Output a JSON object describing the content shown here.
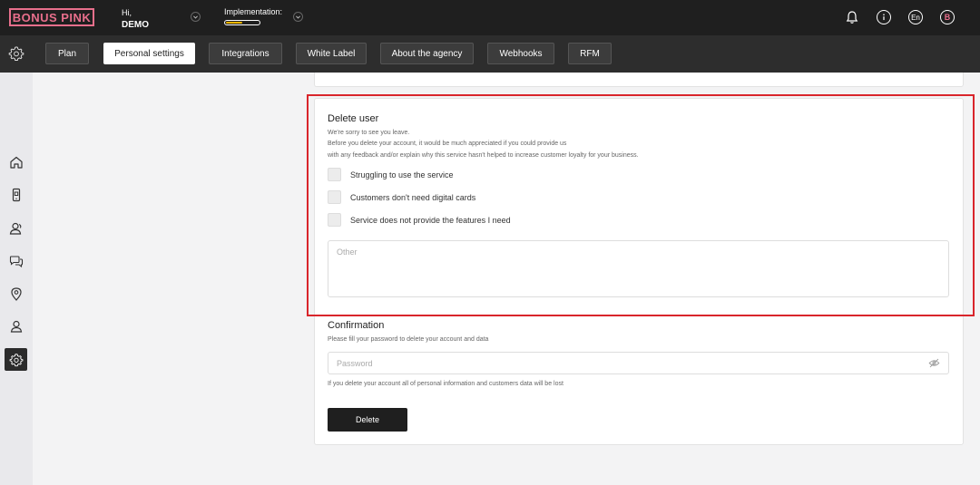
{
  "header": {
    "logo_text": "BONUS PINK",
    "greeting": "Hi,",
    "user_name": "DEMO",
    "implementation_label": "Implementation:",
    "implementation_progress": 0.5,
    "language": "En",
    "avatar_letter": "B"
  },
  "tabs": [
    {
      "label": "Plan"
    },
    {
      "label": "Personal settings"
    },
    {
      "label": "Integrations"
    },
    {
      "label": "White Label"
    },
    {
      "label": "About the agency"
    },
    {
      "label": "Webhooks"
    },
    {
      "label": "RFM"
    }
  ],
  "sidebar": {
    "icons": [
      "home-icon",
      "phone-card-icon",
      "customers-icon",
      "chat-icon",
      "location-icon",
      "user-icon",
      "settings-icon"
    ],
    "active": "settings-icon"
  },
  "delete_user": {
    "title": "Delete user",
    "line1": "We're sorry to see you leave.",
    "line2": "Before you delete your account, it would be much appreciated if you could provide us",
    "line3": "with any feedback and/or explain why this service hasn't helped to increase customer loyalty for your business.",
    "reasons": [
      "Struggling to use the service",
      "Customers don't need digital cards",
      "Service does not provide the features I need"
    ],
    "other_placeholder": "Other"
  },
  "confirmation": {
    "title": "Confirmation",
    "description": "Please fill your password to delete your account and data",
    "password_placeholder": "Password",
    "warning": "If you delete your account all of personal information and customers data will be lost",
    "delete_label": "Delete"
  },
  "colors": {
    "brand": "#e86f8c",
    "highlight": "#d9252b",
    "progress": "#f2b600"
  }
}
